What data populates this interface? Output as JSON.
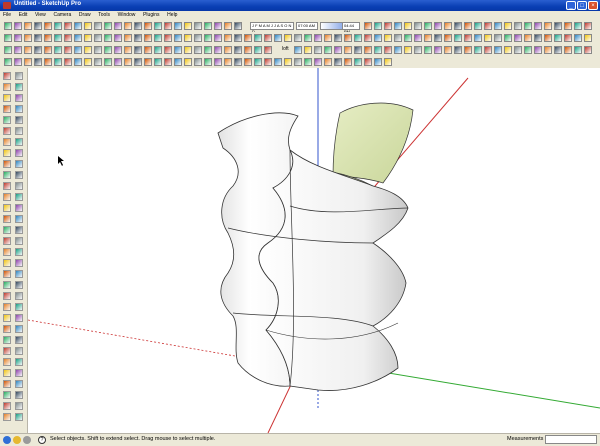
{
  "window": {
    "title": "Untitled - SketchUp Pro"
  },
  "menu": {
    "items": [
      "File",
      "Edit",
      "View",
      "Camera",
      "Draw",
      "Tools",
      "Window",
      "Plugins",
      "Help"
    ]
  },
  "toolbar": {
    "months": "J F M A M J J A S O N D",
    "time_start": "07:00 AM",
    "time_end": "04:44 PM",
    "loft_label": "loft"
  },
  "status": {
    "hint": "Select objects. Shift to extend select. Drag mouse to select multiple.",
    "measurements_label": "Measurements",
    "measurements_value": ""
  },
  "colors": {
    "title_blue": "#0a3fb4",
    "chrome": "#ece9d8",
    "axis_red": "#cc3333",
    "axis_green": "#33aa33",
    "axis_blue": "#3355cc",
    "inner_face": "#d8e3b0"
  }
}
